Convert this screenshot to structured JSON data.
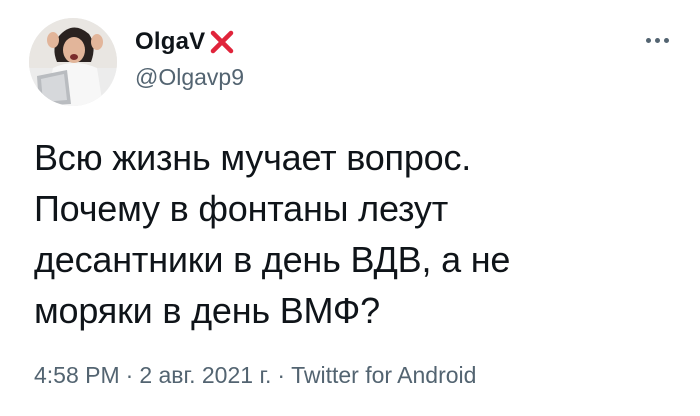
{
  "author": {
    "display_name": "OlgaV",
    "name_emoji": "red-x-emoji",
    "handle": "@Olgavp9",
    "avatar": "avatar-woman-at-laptop"
  },
  "tweet": {
    "text": "Всю жизнь мучает вопрос.\nПочему в фонтаны лезут\nдесантники в день ВДВ, а не\nморяки в день ВМФ?",
    "time": "4:58 PM",
    "separator": "·",
    "date": "2 авг. 2021 г.",
    "source": "Twitter for Android"
  },
  "icons": {
    "more": "more-horizontal-icon"
  },
  "colors": {
    "text": "#0f1419",
    "secondary": "#536471",
    "emoji_red": "#e0243b",
    "background": "#ffffff"
  }
}
